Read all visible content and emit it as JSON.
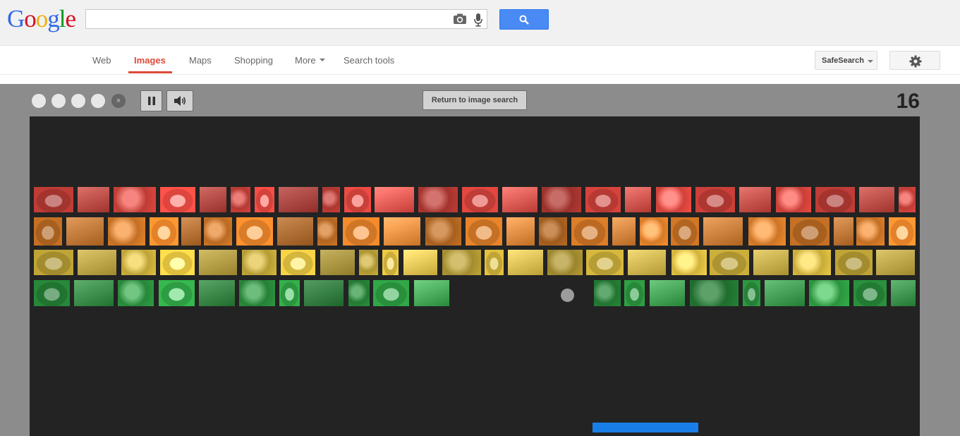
{
  "header": {
    "logo_letters": [
      {
        "char": "G",
        "color": "#3369e8"
      },
      {
        "char": "o",
        "color": "#d50f25"
      },
      {
        "char": "o",
        "color": "#eeb211"
      },
      {
        "char": "g",
        "color": "#3369e8"
      },
      {
        "char": "l",
        "color": "#009925"
      },
      {
        "char": "e",
        "color": "#d50f25"
      }
    ],
    "search": {
      "value": "",
      "placeholder": ""
    },
    "icons": {
      "camera": "camera-icon",
      "mic": "mic-icon",
      "search": "search-icon"
    },
    "brand_blue": "#4a8af4"
  },
  "nav": {
    "items": [
      {
        "label": "Web",
        "active": false
      },
      {
        "label": "Images",
        "active": true
      },
      {
        "label": "Maps",
        "active": false
      },
      {
        "label": "Shopping",
        "active": false
      },
      {
        "label": "More",
        "active": false,
        "dropdown": true
      },
      {
        "label": "Search tools",
        "active": false
      }
    ],
    "active_color": "#dd4b39",
    "safesearch_label": "SafeSearch",
    "settings_icon": "gear-icon"
  },
  "game": {
    "lives_remaining": 4,
    "close_icon": "×",
    "pause_icon": "pause-icon",
    "sound_icon": "speaker-icon",
    "return_label": "Return to image search",
    "score": "16",
    "ball_color": "#9c9c9c",
    "paddle_color": "#1a7ee8",
    "brick_rows": [
      {
        "tint": "red",
        "count": 23
      },
      {
        "tint": "orange",
        "count": 23
      },
      {
        "tint": "yellow",
        "count": 23
      },
      {
        "tint": "green",
        "count": 20
      }
    ],
    "tint_colors": {
      "red": "#e2473f",
      "orange": "#e8842a",
      "yellow": "#e2c240",
      "green": "#2ea043"
    }
  }
}
